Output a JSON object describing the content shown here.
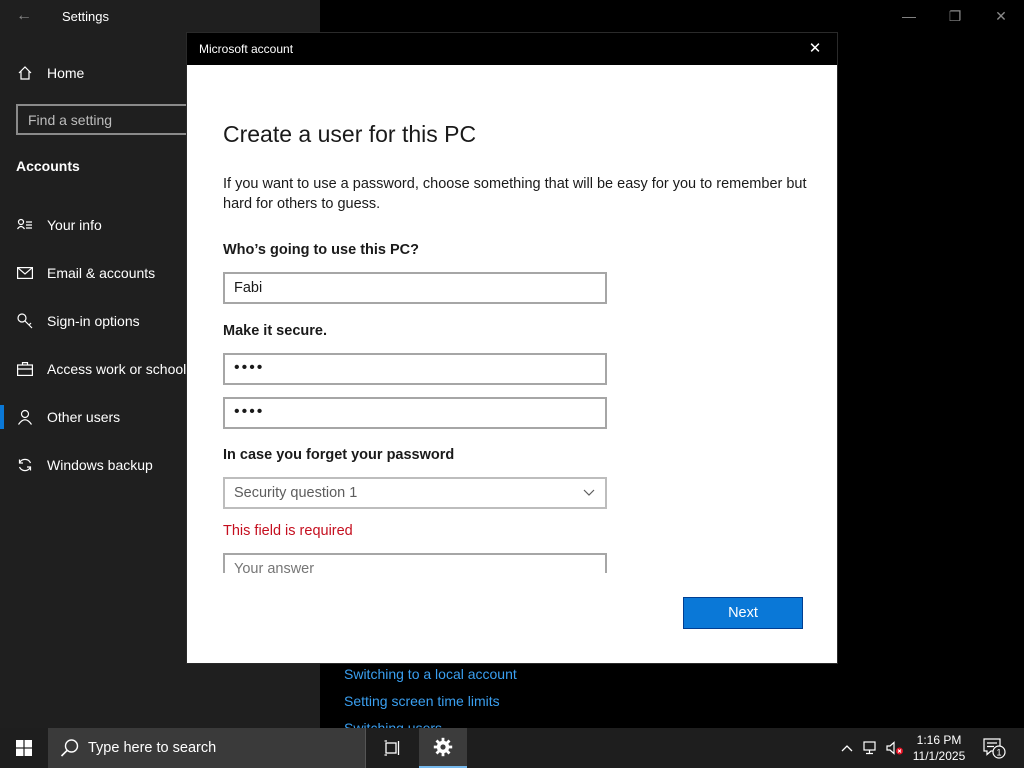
{
  "settings": {
    "title": "Settings",
    "home": "Home",
    "search_placeholder": "Find a setting",
    "section": "Accounts",
    "nav": [
      {
        "label": "Your info",
        "icon": "person-card-icon"
      },
      {
        "label": "Email & accounts",
        "icon": "mail-icon"
      },
      {
        "label": "Sign-in options",
        "icon": "key-icon"
      },
      {
        "label": "Access work or school",
        "icon": "briefcase-icon"
      },
      {
        "label": "Other users",
        "icon": "person-icon",
        "active": true
      },
      {
        "label": "Windows backup",
        "icon": "sync-icon"
      }
    ],
    "links": [
      "Switching to a local account",
      "Setting screen time limits",
      "Switching users"
    ]
  },
  "dialog": {
    "title": "Microsoft account",
    "heading": "Create a user for this PC",
    "intro": "If you want to use a password, choose something that will be easy for you to remember but hard for others to guess.",
    "who_label": "Who’s going to use this PC?",
    "name_value": "Fabi",
    "secure_label": "Make it secure.",
    "password_value": "••••",
    "confirm_value": "••••",
    "forget_label": "In case you forget your password",
    "question_value": "Security question 1",
    "error": "This field is required",
    "answer_placeholder": "Your answer",
    "next": "Next"
  },
  "taskbar": {
    "search_text": "Type here to search",
    "time": "1:16 PM",
    "date": "11/1/2025",
    "notification_count": "1"
  },
  "colors": {
    "accent": "#0a78d7",
    "error": "#c50f1f",
    "link": "#3a9ff0"
  }
}
